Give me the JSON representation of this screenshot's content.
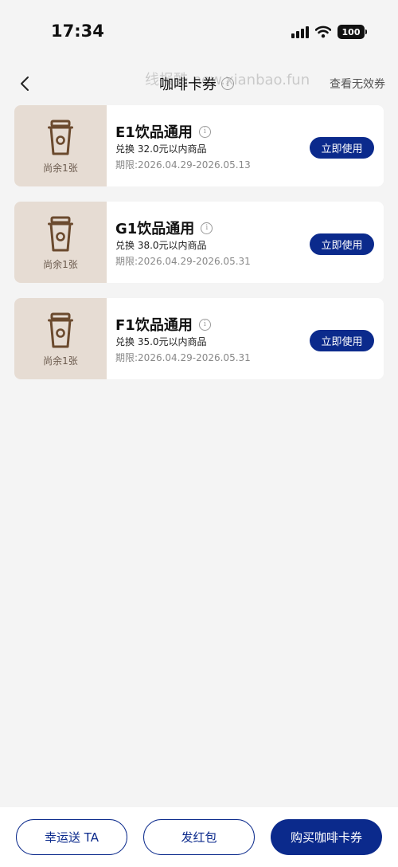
{
  "status_bar": {
    "time": "17:34",
    "battery": "100"
  },
  "header": {
    "title": "咖啡卡券",
    "info": "i",
    "watermark": "线报酷 new.xianbao.fun",
    "invalid_link": "查看无效券"
  },
  "coupons": [
    {
      "title": "E1饮品通用",
      "desc": "兑换 32.0元以内商品",
      "period": "期限:2026.04.29-2026.05.13",
      "remain": "尚余1张",
      "button": "立即使用",
      "info": "i"
    },
    {
      "title": "G1饮品通用",
      "desc": "兑换 38.0元以内商品",
      "period": "期限:2026.04.29-2026.05.31",
      "remain": "尚余1张",
      "button": "立即使用",
      "info": "i"
    },
    {
      "title": "F1饮品通用",
      "desc": "兑换 35.0元以内商品",
      "period": "期限:2026.04.29-2026.05.31",
      "remain": "尚余1张",
      "button": "立即使用",
      "info": "i"
    }
  ],
  "bottom_bar": {
    "lucky_label": "幸运送 TA",
    "redpacket_label": "发红包",
    "buy_label": "购买咖啡卡券"
  },
  "colors": {
    "brand": "#0b2a8c",
    "coupon_left_bg": "#e6dcd3",
    "cup": "#6b4a2e"
  },
  "icons": {
    "back": "chevron-left-icon",
    "cup": "coffee-cup-icon",
    "info": "info-icon"
  }
}
